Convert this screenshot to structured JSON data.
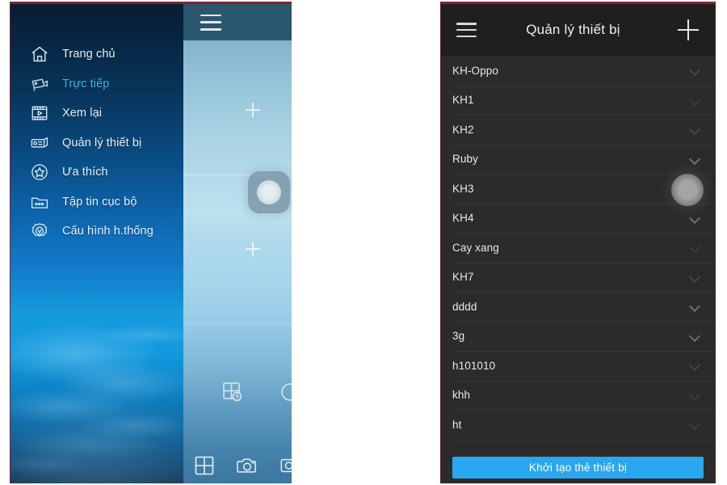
{
  "left_screen": {
    "drawer": {
      "items": [
        {
          "label": "Trang chủ",
          "icon": "home-icon",
          "active": false
        },
        {
          "label": "Trực tiếp",
          "icon": "camera-icon",
          "active": true
        },
        {
          "label": "Xem lại",
          "icon": "playback-icon",
          "active": false
        },
        {
          "label": "Quản lý thiết bị",
          "icon": "device-icon",
          "active": false
        },
        {
          "label": "Ưa thích",
          "icon": "star-circle-icon",
          "active": false
        },
        {
          "label": "Tập tin cục bộ",
          "icon": "folder-icon",
          "active": false
        },
        {
          "label": "Cấu hình h.thống",
          "icon": "gear-icon",
          "active": false
        }
      ]
    },
    "live_view": {
      "menu_icon": "hamburger-icon",
      "add_channel_icon": "plus-icon",
      "drag_handle_icon": "floating-handle-icon",
      "overlay_icons": [
        {
          "name": "grid-clock-icon"
        },
        {
          "name": "circle-icon"
        }
      ],
      "toolbar": [
        {
          "name": "grid-layout-icon"
        },
        {
          "name": "snapshot-camera-icon"
        },
        {
          "name": "record-icon"
        }
      ]
    }
  },
  "right_screen": {
    "header": {
      "menu_icon": "hamburger-icon",
      "title": "Quản lý thiết bị",
      "add_icon": "plus-icon"
    },
    "devices": [
      {
        "name": "KH-Oppo",
        "chevron": "chevron-down-icon",
        "chevron_state": "dim"
      },
      {
        "name": "KH1",
        "chevron": "chevron-down-icon",
        "chevron_state": "dim2"
      },
      {
        "name": "KH2",
        "chevron": "chevron-down-icon",
        "chevron_state": "dim"
      },
      {
        "name": "Ruby",
        "chevron": "chevron-down-icon",
        "chevron_state": "normal"
      },
      {
        "name": "KH3",
        "chevron": "chevron-down-icon",
        "chevron_state": "dim2"
      },
      {
        "name": "KH4",
        "chevron": "chevron-down-icon",
        "chevron_state": "normal"
      },
      {
        "name": "Cay xang",
        "chevron": "chevron-down-icon",
        "chevron_state": "dim2"
      },
      {
        "name": "KH7",
        "chevron": "chevron-down-icon",
        "chevron_state": "dim"
      },
      {
        "name": "dddd",
        "chevron": "chevron-down-icon",
        "chevron_state": "normal"
      },
      {
        "name": "3g",
        "chevron": "chevron-down-icon",
        "chevron_state": "normal"
      },
      {
        "name": "h101010",
        "chevron": "chevron-down-icon",
        "chevron_state": "dim"
      },
      {
        "name": "khh",
        "chevron": "chevron-down-icon",
        "chevron_state": "dim2"
      },
      {
        "name": "ht",
        "chevron": "chevron-down-icon",
        "chevron_state": "dim2"
      },
      {
        "name": ". . . . .",
        "chevron": "chevron-down-icon",
        "chevron_state": "dim2"
      }
    ],
    "floating_button_icon": "floating-overlay-icon",
    "cta_label": "Khởi tạo thẻ thiết bị"
  },
  "colors": {
    "accent_blue": "#29a7f0",
    "active_menu": "#3fb8f0",
    "dark_panel": "#2b2b2b",
    "dark_header": "#201f1f",
    "live_topbar": "#2a566e",
    "border_maroon": "#7e2535"
  }
}
